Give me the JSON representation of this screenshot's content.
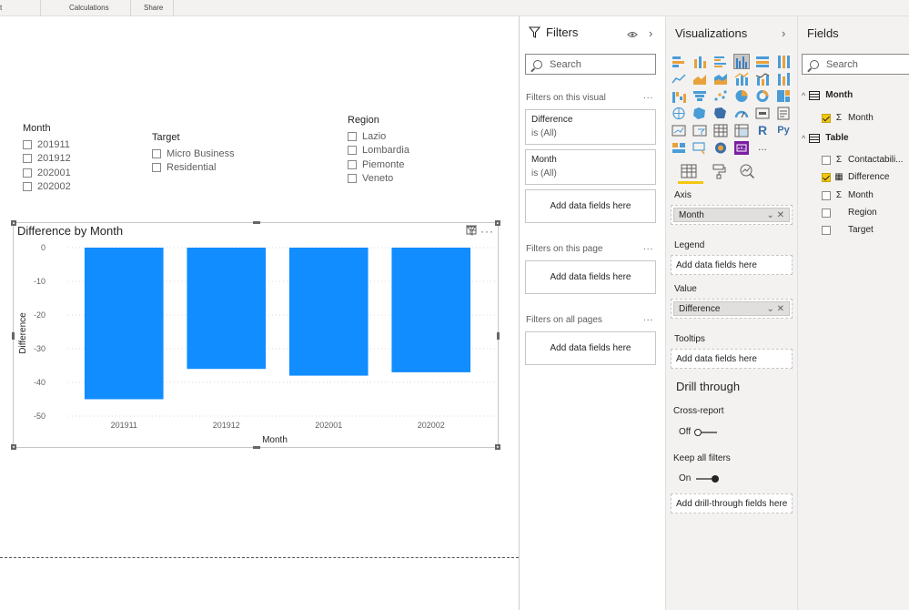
{
  "ribbon": {
    "groups": [
      "t",
      "Calculations",
      "Share"
    ]
  },
  "slicers": {
    "month": {
      "title": "Month",
      "items": [
        "201911",
        "201912",
        "202001",
        "202002"
      ]
    },
    "target": {
      "title": "Target",
      "items": [
        "Micro Business",
        "Residential"
      ]
    },
    "region": {
      "title": "Region",
      "items": [
        "Lazio",
        "Lombardia",
        "Piemonte",
        "Veneto"
      ]
    }
  },
  "chart_data": {
    "type": "bar",
    "title": "Difference by Month",
    "categories": [
      "201911",
      "201912",
      "202001",
      "202002"
    ],
    "values": [
      -45,
      -36,
      -38,
      -37
    ],
    "xlabel": "Month",
    "ylabel": "Difference",
    "ylim": [
      -50,
      0
    ],
    "yticks": [
      "0",
      "-10",
      "-20",
      "-30",
      "-40",
      "-50"
    ],
    "grid": true,
    "color": "#118dff"
  },
  "filters": {
    "title": "Filters",
    "on_visual_label": "Filters on this visual",
    "cards": [
      {
        "field": "Difference",
        "state": "is (All)"
      },
      {
        "field": "Month",
        "state": "is (All)"
      }
    ],
    "add_label": "Add data fields here",
    "on_page_label": "Filters on this page",
    "on_all_label": "Filters on all pages",
    "more": "..."
  },
  "visualizations": {
    "title": "Visualizations",
    "axis_label": "Axis",
    "axis_value": "Month",
    "legend_label": "Legend",
    "legend_placeholder": "Add data fields here",
    "value_label": "Value",
    "value_value": "Difference",
    "tooltips_label": "Tooltips",
    "tooltips_placeholder": "Add data fields here",
    "drill_title": "Drill through",
    "cross_report_label": "Cross-report",
    "cross_report_state": "Off",
    "keep_filters_label": "Keep all filters",
    "keep_filters_state": "On",
    "drill_placeholder": "Add drill-through fields here",
    "r_label": "R",
    "py_label": "Py",
    "more": "..."
  },
  "fields": {
    "title": "Fields",
    "search_placeholder": "Search",
    "tables": [
      {
        "name": "Month",
        "fields": [
          {
            "name": "Month",
            "checked": true,
            "kind": "sigma"
          }
        ]
      },
      {
        "name": "Table",
        "fields": [
          {
            "name": "Contactabili...",
            "checked": false,
            "kind": "sigma"
          },
          {
            "name": "Difference",
            "checked": true,
            "kind": "calc"
          },
          {
            "name": "Month",
            "checked": false,
            "kind": "sigma"
          },
          {
            "name": "Region",
            "checked": false,
            "kind": "none"
          },
          {
            "name": "Target",
            "checked": false,
            "kind": "none"
          }
        ]
      }
    ]
  },
  "filters_search_placeholder": "Search",
  "colors": {
    "accent": "#f2c811",
    "bar": "#118dff"
  }
}
